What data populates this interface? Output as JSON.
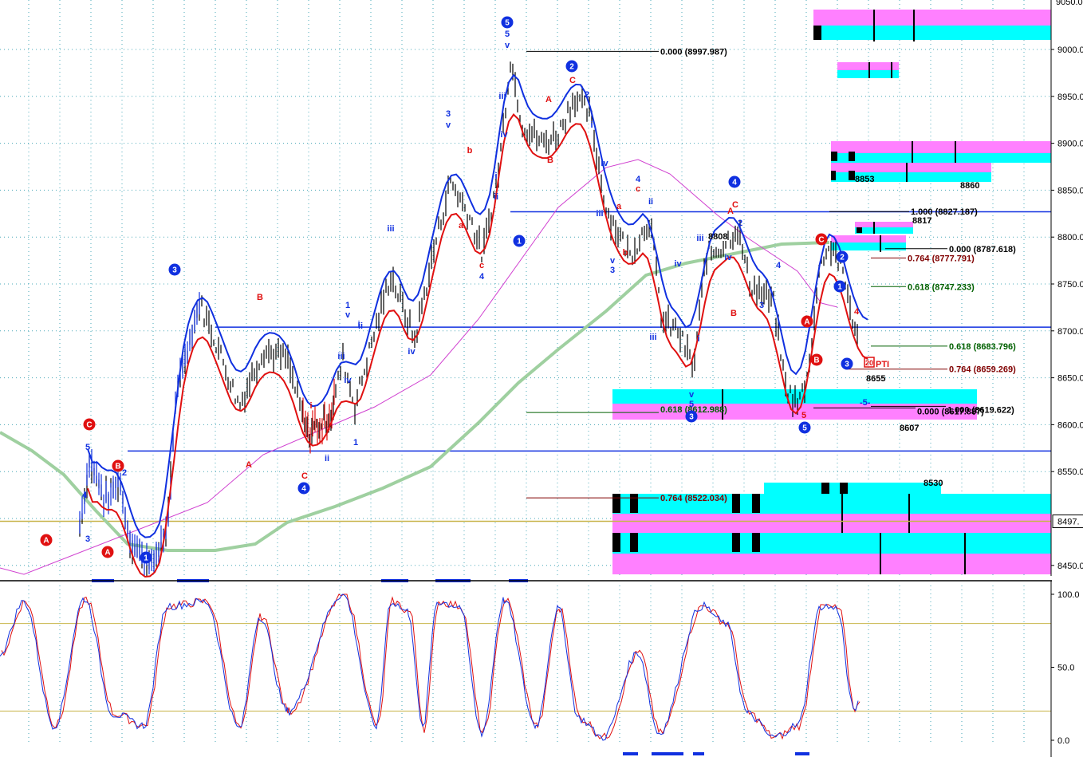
{
  "chart_data": [
    {
      "type": "line",
      "panel": "price",
      "ylim": [
        8440,
        9040
      ],
      "y_ticks": [
        "9000.0",
        "8950.0",
        "8900.0",
        "8850.0",
        "8800.0",
        "8750.0",
        "8700.0",
        "8650.0",
        "8600.0",
        "8550.0",
        "8450.0"
      ],
      "y_tick_values": [
        9000,
        8950,
        8900,
        8850,
        8800,
        8750,
        8700,
        8650,
        8600,
        8550,
        8450
      ],
      "top_partial_tick": "9050.0",
      "current_price_label": "8497.",
      "current_price": 8497,
      "grid": true,
      "colors": {
        "upper_band": "#1030e0",
        "lower_band": "#e01010",
        "long_ma": "#9fd0a0",
        "thin_ma": "#d040d0",
        "bars": "#000000",
        "cyan": "#00ffff",
        "magenta": "#ff80ff"
      },
      "horizontal_lines": [
        {
          "name": "resistance",
          "y": 8827,
          "color": "#1030e0"
        },
        {
          "name": "pivot",
          "y": 8704,
          "color": "#1030e0"
        },
        {
          "name": "support",
          "y": 8572,
          "color": "#1030e0"
        },
        {
          "name": "yellow-line",
          "y": 8497,
          "color": "#c8b44a"
        }
      ],
      "fib_levels": [
        {
          "label": "0.000 (8997.987)",
          "value": 8997.987,
          "color": "#000000"
        },
        {
          "label": "1.000 (8827.187)",
          "value": 8827.187,
          "color": "#000000"
        },
        {
          "label": "0.000 (8787.618)",
          "value": 8787.618,
          "color": "#000000"
        },
        {
          "label": "0.764 (8777.791)",
          "value": 8777.791,
          "color": "#800000"
        },
        {
          "label": "0.618 (8747.233)",
          "value": 8747.233,
          "color": "#006000"
        },
        {
          "label": "0.618 (8683.796)",
          "value": 8683.796,
          "color": "#006000"
        },
        {
          "label": "0.764 (8659.269)",
          "value": 8659.269,
          "color": "#800000"
        },
        {
          "label": "0.000 (8617.887)",
          "value": 8617.887,
          "color": "#000000"
        },
        {
          "label": "1.000 (8619.622)",
          "value": 8619.622,
          "color": "#000000"
        },
        {
          "label": "0.618 (8612.988)",
          "value": 8612.988,
          "color": "#006000"
        },
        {
          "label": "0.764 (8522.034)",
          "value": 8522.034,
          "color": "#800000"
        }
      ],
      "price_labels": [
        "8853",
        "8860",
        "8817",
        "8808",
        "8655",
        "8607",
        "8530",
        "-5-",
        "PTI",
        "20"
      ],
      "price_label_values": [
        8853,
        8860,
        8817,
        8808,
        8655,
        8607,
        8530
      ],
      "wave_labels": [
        "5",
        "v",
        "2",
        "C",
        "A",
        "B",
        "1",
        "3",
        "4",
        "i",
        "ii",
        "iii",
        "iv",
        "a",
        "b",
        "c"
      ],
      "circle_labels": [
        "A",
        "B",
        "C",
        "1",
        "2",
        "3",
        "4",
        "5"
      ]
    },
    {
      "type": "line",
      "panel": "stochastic",
      "ylim": [
        0,
        100
      ],
      "y_ticks": [
        "100.0",
        "50.0",
        "0.0"
      ],
      "y_tick_values": [
        100,
        50,
        0
      ],
      "overbought": 80,
      "oversold": 20,
      "series": [
        {
          "color": "#1030e0"
        },
        {
          "color": "#e01010"
        }
      ]
    }
  ]
}
